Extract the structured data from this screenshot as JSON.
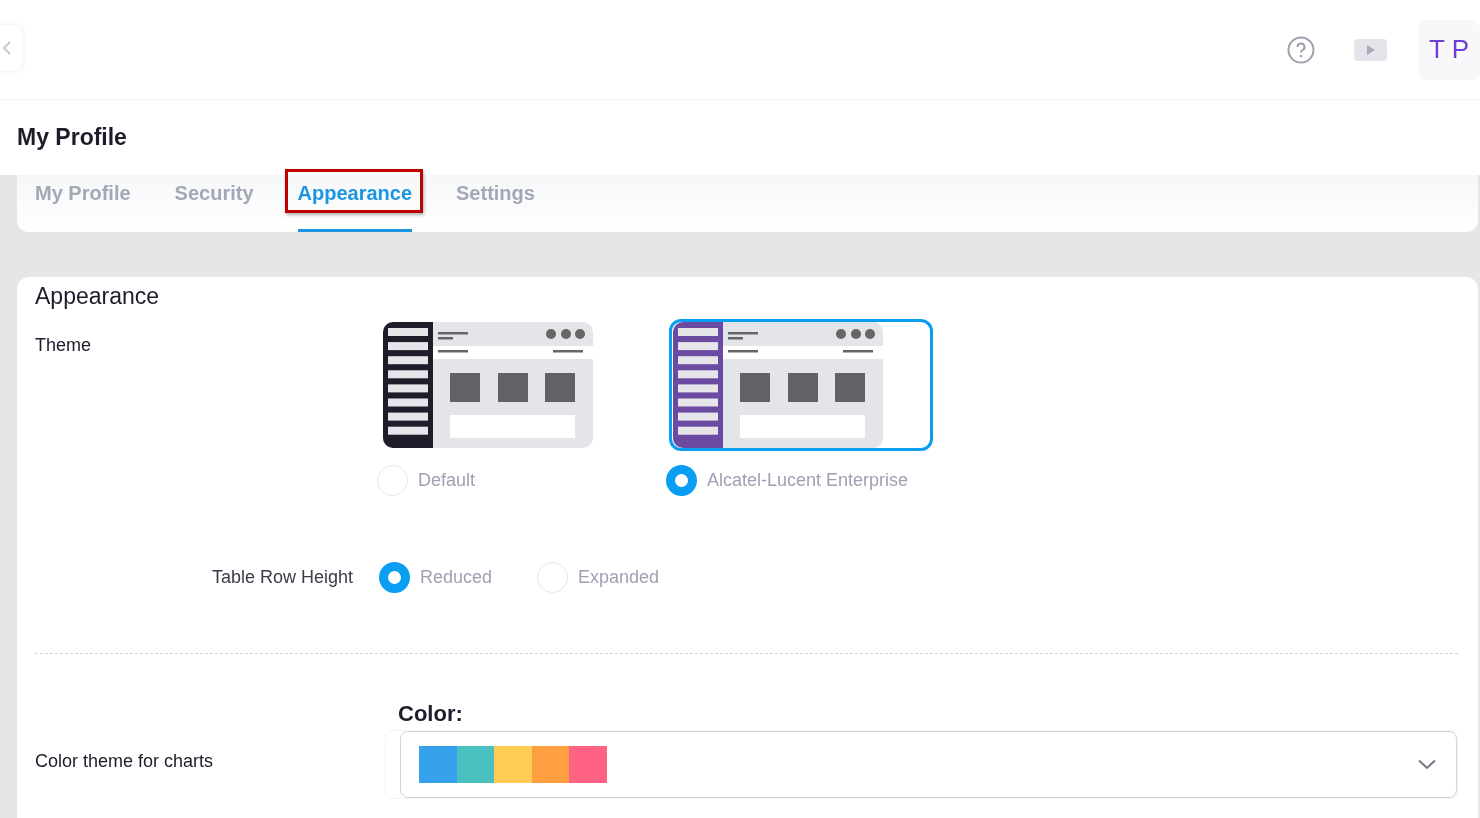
{
  "header": {
    "avatar": "T P"
  },
  "page_title": "My Profile",
  "tabs": [
    {
      "label": "My Profile",
      "selected": false,
      "highlighted": false
    },
    {
      "label": "Security",
      "selected": false,
      "highlighted": false
    },
    {
      "label": "Appearance",
      "selected": true,
      "highlighted": true
    },
    {
      "label": "Settings",
      "selected": false,
      "highlighted": false
    }
  ],
  "section_title": "Appearance",
  "theme": {
    "label": "Theme",
    "options": [
      {
        "label": "Default",
        "selected": false,
        "color": "#1e1e2a"
      },
      {
        "label": "Alcatel-Lucent Enterprise",
        "selected": true,
        "color": "#6b4ba1"
      }
    ]
  },
  "row_height": {
    "label": "Table Row Height",
    "options": [
      {
        "label": "Reduced",
        "selected": true
      },
      {
        "label": "Expanded",
        "selected": false
      }
    ]
  },
  "chart_colors": {
    "label": "Color theme for charts",
    "field_label": "Color:",
    "swatches": [
      {
        "color": "#36a2eb"
      },
      {
        "color": "#4bc0c0"
      },
      {
        "color": "#ffcd56"
      },
      {
        "color": "#ff9f40"
      },
      {
        "color": "#ff6384"
      }
    ]
  }
}
